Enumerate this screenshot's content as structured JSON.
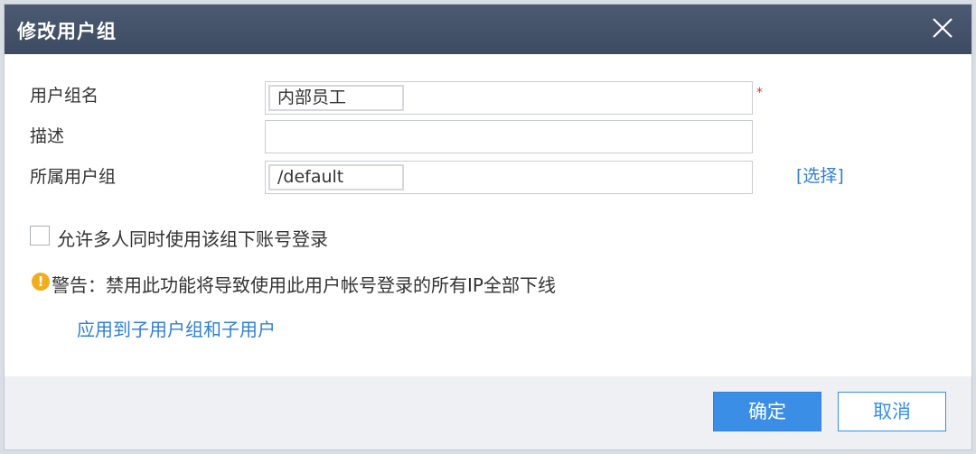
{
  "dialog": {
    "title": "修改用户组",
    "close_icon": "close-icon"
  },
  "form": {
    "group_name_label": "用户组名",
    "group_name_value": "内部员工",
    "required_mark": "*",
    "description_label": "描述",
    "description_value": "",
    "parent_group_label": "所属用户组",
    "parent_group_value": "/default",
    "select_link": "[选择]"
  },
  "options": {
    "multi_login_label": "允许多人同时使用该组下账号登录",
    "multi_login_checked": false,
    "warning_icon": "warning-icon",
    "warning_text": "警告：禁用此功能将导致使用此用户帐号登录的所有IP全部下线",
    "apply_link": "应用到子用户组和子用户"
  },
  "footer": {
    "ok_label": "确定",
    "cancel_label": "取消"
  },
  "colors": {
    "titlebar": "#3d4b62",
    "accent": "#3a8ee6",
    "link": "#2f7fd2",
    "warning": "#f0ad1e",
    "required": "#d9322c"
  }
}
